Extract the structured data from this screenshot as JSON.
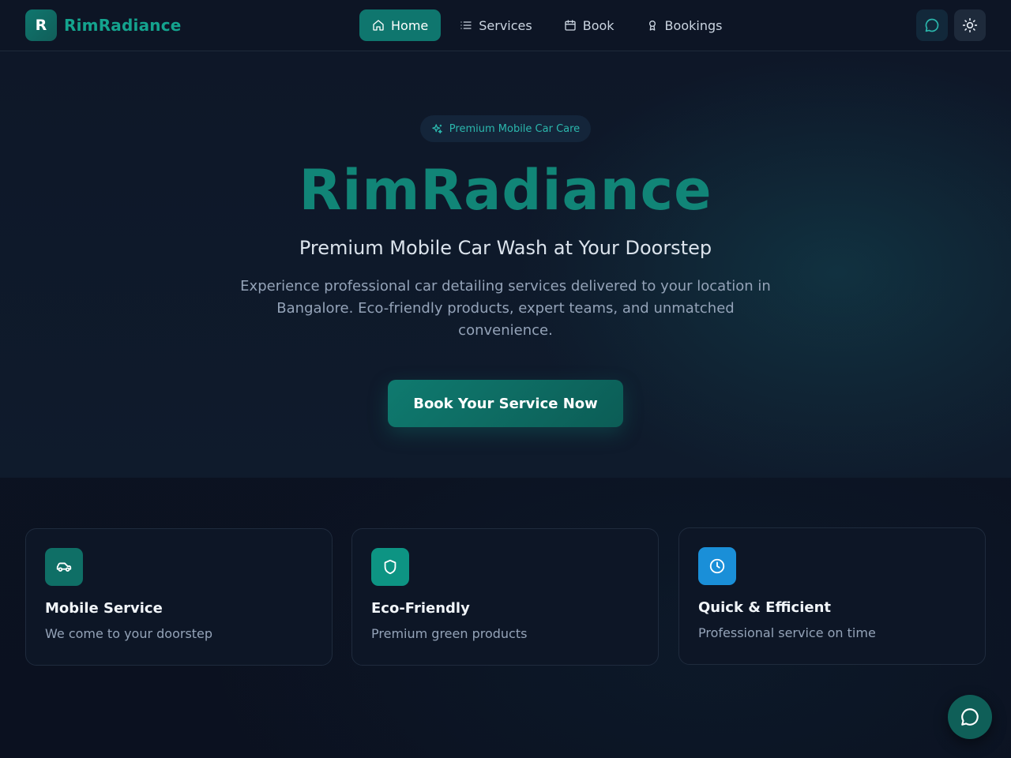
{
  "brand": {
    "logo_letter": "R",
    "name": "RimRadiance"
  },
  "nav": {
    "items": [
      {
        "label": "Home",
        "icon": "home-icon",
        "active": true
      },
      {
        "label": "Services",
        "icon": "list-icon",
        "active": false
      },
      {
        "label": "Book",
        "icon": "calendar-icon",
        "active": false
      },
      {
        "label": "Bookings",
        "icon": "award-icon",
        "active": false
      }
    ]
  },
  "header_actions": {
    "chat_icon": "chat-bubble-icon",
    "theme_icon": "sun-icon"
  },
  "hero": {
    "badge": "Premium Mobile Car Care",
    "badge_icon": "sparkles-icon",
    "title": "RimRadiance",
    "subtitle": "Premium Mobile Car Wash at Your Doorstep",
    "description": "Experience professional car detailing services delivered to your location in Bangalore. Eco-friendly products, expert teams, and unmatched convenience.",
    "cta_label": "Book Your Service Now"
  },
  "features": [
    {
      "title": "Mobile Service",
      "text": "We come to your doorstep",
      "icon": "car-icon",
      "color": "#0f766e"
    },
    {
      "title": "Eco-Friendly",
      "text": "Premium green products",
      "icon": "shield-icon",
      "color": "#0d9488"
    },
    {
      "title": "Quick & Efficient",
      "text": "Professional service on time",
      "icon": "clock-icon",
      "color": "#1a8fd8"
    }
  ],
  "colors": {
    "accent": "#0f766e",
    "brand_text": "#14a38e",
    "background": "#0b1120"
  },
  "fab": {
    "icon": "chat-bubble-icon"
  }
}
